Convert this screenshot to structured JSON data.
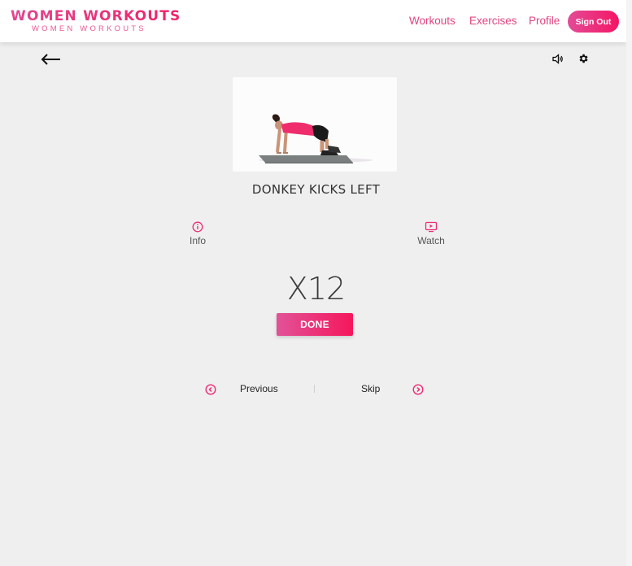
{
  "header": {
    "brand_title": "WOMEN WORKOUTS",
    "brand_subtitle": "WOMEN WORKOUTS",
    "nav": {
      "workouts": "Workouts",
      "exercises": "Exercises",
      "profile": "Profile"
    },
    "signout_label": "Sign Out"
  },
  "toolbar": {
    "back_icon": "arrow-left-icon",
    "sound_icon": "volume-icon",
    "settings_icon": "gear-icon"
  },
  "exercise": {
    "title": "DONKEY KICKS LEFT",
    "reps": "X12",
    "done_label": "DONE"
  },
  "actions": {
    "info_label": "Info",
    "watch_label": "Watch"
  },
  "pager": {
    "previous_label": "Previous",
    "skip_label": "Skip"
  },
  "colors": {
    "accent": "#ed2a73",
    "accent_light": "#e24b97",
    "background": "#efefef"
  }
}
